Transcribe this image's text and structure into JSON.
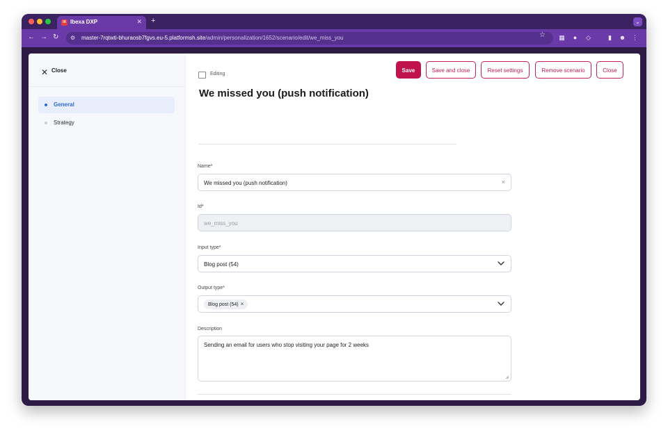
{
  "browser": {
    "tab_title": "Ibexa DXP",
    "tab_favicon_text": "IX",
    "url_host": "master-7rqtwti-bhuraosb7fgvs.eu-5.platformsh.site",
    "url_path": "/admin/personalization/1652/scenario/edit/we_miss_you"
  },
  "sidebar": {
    "close_label": "Close",
    "items": [
      {
        "label": "General",
        "active": true
      },
      {
        "label": "Strategy",
        "active": false
      }
    ]
  },
  "header": {
    "status_label": "Editing",
    "title": "We missed you (push notification)",
    "buttons": {
      "save": "Save",
      "save_close": "Save and close",
      "reset": "Reset settings",
      "remove": "Remove scenario",
      "close": "Close"
    }
  },
  "form": {
    "name": {
      "label": "Name*",
      "value": "We missed you (push notification)"
    },
    "id": {
      "label": "Id*",
      "value": "we_miss_you"
    },
    "input_type": {
      "label": "Input type*",
      "value": "Blog post (54)"
    },
    "output_type": {
      "label": "Output type*",
      "chip": "Blog post (54)"
    },
    "description": {
      "label": "Description",
      "value": "Sending an email for users who stop visiting your page for 2 weeks"
    }
  },
  "colors": {
    "accent": "#c0134d",
    "active_nav": "#2a6ad8",
    "browser_frame": "#6a3aa8"
  }
}
